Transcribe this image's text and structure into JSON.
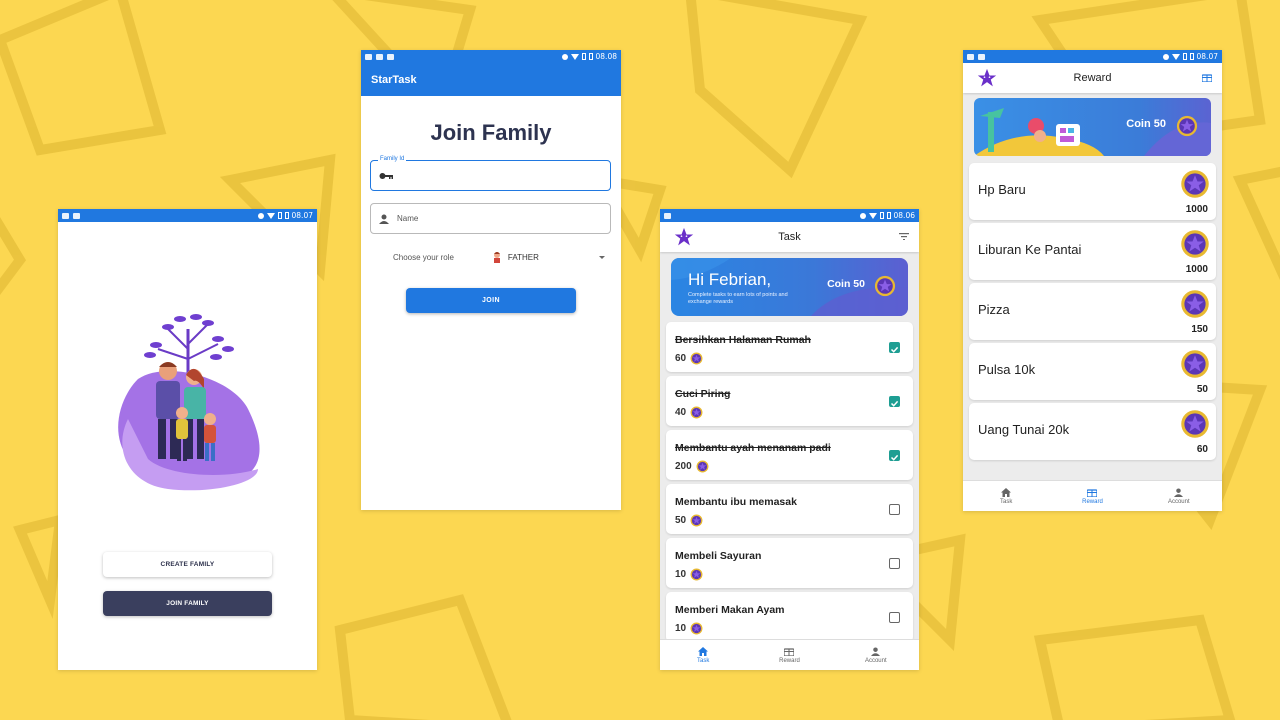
{
  "colors": {
    "background": "#fcd751",
    "primary": "#2078e0",
    "dark_button": "#3a3f5e",
    "checked": "#1e9e93",
    "star": "#6a2fc9",
    "coin_gold": "#e8b931"
  },
  "status_times": {
    "p1": "08.07",
    "p2": "08.08",
    "p3": "08.06",
    "p4": "08.07"
  },
  "onboarding": {
    "create_label": "CREATE FAMILY",
    "join_label": "JOIN FAMILY"
  },
  "join": {
    "appbar_title": "StarTask",
    "title": "Join Family",
    "family_id_label": "Family Id",
    "family_id_value": "",
    "name_placeholder": "Name",
    "role_label": "Choose your role",
    "role_value": "FATHER",
    "submit_label": "JOIN"
  },
  "task_screen": {
    "title": "Task",
    "greeting": "Hi Febrian,",
    "subtitle": "Complete tasks to earn lots of points and exchange rewards",
    "coin_label": "Coin 50",
    "tasks": [
      {
        "name": "Bersihkan Halaman Rumah",
        "points": "60",
        "done": true
      },
      {
        "name": "Cuci Piring",
        "points": "40",
        "done": true
      },
      {
        "name": "Membantu ayah menanam padi",
        "points": "200",
        "done": true
      },
      {
        "name": "Membantu ibu memasak",
        "points": "50",
        "done": false
      },
      {
        "name": "Membeli Sayuran",
        "points": "10",
        "done": false
      },
      {
        "name": "Memberi Makan Ayam",
        "points": "10",
        "done": false
      }
    ]
  },
  "reward_screen": {
    "title": "Reward",
    "coin_label": "Coin 50",
    "rewards": [
      {
        "name": "Hp Baru",
        "cost": "1000"
      },
      {
        "name": "Liburan Ke Pantai",
        "cost": "1000"
      },
      {
        "name": "Pizza",
        "cost": "150"
      },
      {
        "name": "Pulsa 10k",
        "cost": "50"
      },
      {
        "name": "Uang Tunai 20k",
        "cost": "60"
      }
    ]
  },
  "nav": {
    "task": "Task",
    "reward": "Reward",
    "account": "Account"
  }
}
